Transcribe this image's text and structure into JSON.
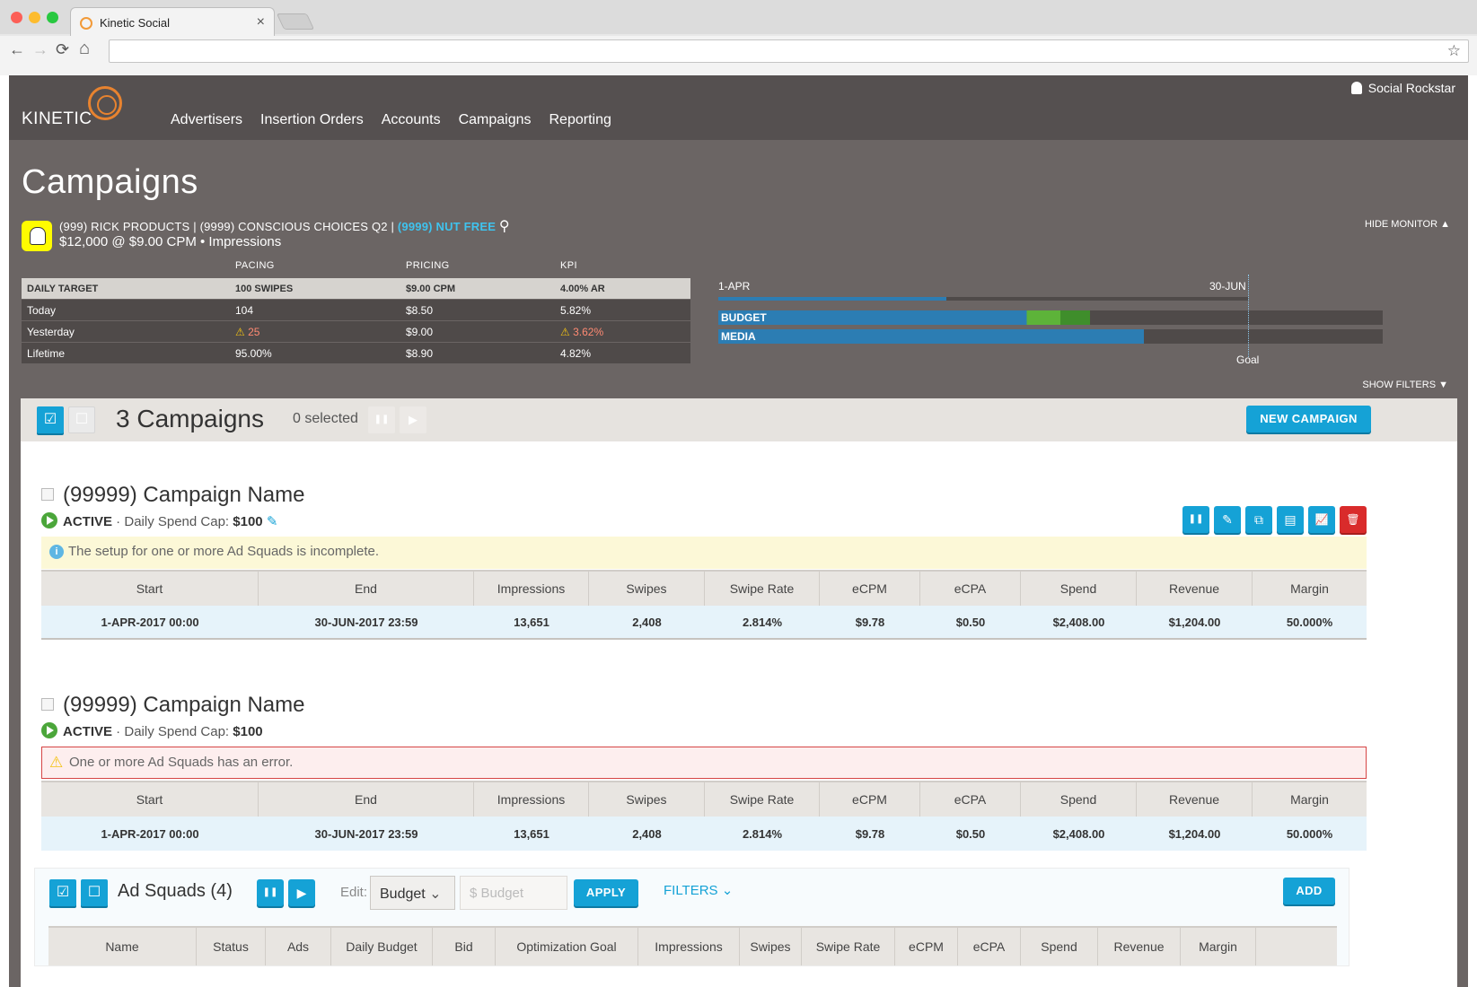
{
  "browser": {
    "tab_title": "Kinetic Social",
    "close": "×",
    "back": "←",
    "forward": "→",
    "reload": "⟳",
    "home": "⌂",
    "star": "☆"
  },
  "brand": {
    "name": "KINETIC"
  },
  "nav": {
    "items": [
      "Advertisers",
      "Insertion Orders",
      "Accounts",
      "Campaigns",
      "Reporting"
    ],
    "user": "Social Rockstar"
  },
  "page": {
    "title": "Campaigns",
    "crumb_main": "(999) RICK PRODUCTS | (9999) CONSCIOUS CHOICES Q2 |",
    "crumb_highlight": "(9999) NUT FREE",
    "search_icon": "⚲",
    "subline": "$12,000 @ $9.00 CPM • Impressions",
    "hide_monitor": "HIDE MONITOR ▲",
    "show_filters": "SHOW FILTERS ▼"
  },
  "monitor": {
    "headers": [
      "",
      "PACING",
      "PRICING",
      "KPI"
    ],
    "target": [
      "DAILY TARGET",
      "100 SWIPES",
      "$9.00 CPM",
      "4.00% AR"
    ],
    "today": [
      "Today",
      "104",
      "$8.50",
      "5.82%"
    ],
    "yesterday": [
      "Yesterday",
      "25",
      "$9.00",
      "3.62%"
    ],
    "lifetime": [
      "Lifetime",
      "95.00%",
      "$8.90",
      "4.82%"
    ],
    "warn_glyph": "⚠"
  },
  "pacing": {
    "start": "1-APR",
    "end": "30-JUN",
    "goal": "Goal",
    "budget_label": "BUDGET",
    "media_label": "MEDIA",
    "time_elapsed": 0.43,
    "budget_progress": 0.56,
    "media_progress": 0.64
  },
  "list": {
    "count_title": "3 Campaigns",
    "selected": "0 selected",
    "pause_glyph": "❚❚",
    "play_glyph": "▶",
    "check_glyph": "☑",
    "box_glyph": "☐",
    "new_campaign": "NEW CAMPAIGN"
  },
  "table_headers": [
    "Start",
    "End",
    "Impressions",
    "Swipes",
    "Swipe Rate",
    "eCPM",
    "eCPA",
    "Spend",
    "Revenue",
    "Margin"
  ],
  "campaigns": [
    {
      "name": "(99999) Campaign Name",
      "status": "ACTIVE",
      "cap_label": "Daily Spend Cap:",
      "cap_value": "$100",
      "alert": "The setup for one or more Ad Squads is incomplete.",
      "row": [
        "1-APR-2017 00:00",
        "30-JUN-2017 23:59",
        "13,651",
        "2,408",
        "2.814%",
        "$9.78",
        "$0.50",
        "$2,408.00",
        "$1,204.00",
        "50.000%"
      ]
    },
    {
      "name": "(99999) Campaign Name",
      "status": "ACTIVE",
      "cap_label": "Daily Spend Cap:",
      "cap_value": "$100",
      "alert": "One or more Ad Squads has an error.",
      "row": [
        "1-APR-2017 00:00",
        "30-JUN-2017 23:59",
        "13,651",
        "2,408",
        "2.814%",
        "$9.78",
        "$0.50",
        "$2,408.00",
        "$1,204.00",
        "50.000%"
      ]
    }
  ],
  "actions": {
    "pause": "❚❚",
    "edit": "✎",
    "copy": "⧉",
    "creative": "▤",
    "report": "📈",
    "delete": "🗑",
    "pencil": "✎"
  },
  "adsquads": {
    "title": "Ad Squads (4)",
    "edit_label": "Edit:",
    "select_value": "Budget",
    "select_caret": "⌄",
    "budget_placeholder": "$ Budget",
    "apply": "APPLY",
    "filters": "FILTERS ⌄",
    "add": "ADD",
    "headers": [
      "Name",
      "Status",
      "Ads",
      "Daily Budget",
      "Bid",
      "Optimization Goal",
      "Impressions",
      "Swipes",
      "Swipe Rate",
      "eCPM",
      "eCPA",
      "Spend",
      "Revenue",
      "Margin"
    ]
  },
  "colors": {
    "accent": "#15a2d6",
    "active": "#4ba63a",
    "danger": "#d92b2b",
    "budget_green": "#5db339"
  }
}
